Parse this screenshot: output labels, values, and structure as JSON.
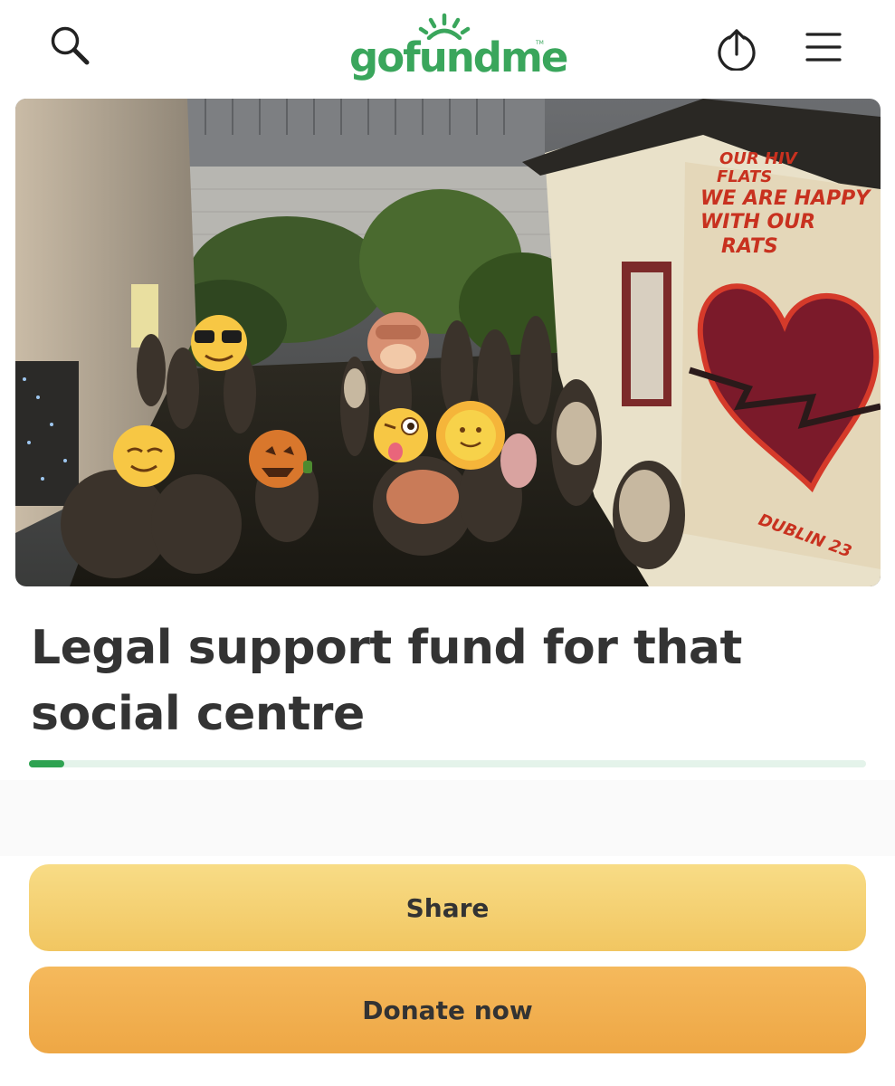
{
  "header": {
    "logo_text": "gofundme",
    "logo_tm": "TM",
    "icons": {
      "search": "search-icon",
      "share": "upload-share-icon",
      "menu": "hamburger-menu-icon"
    }
  },
  "hero": {
    "icon": "photo",
    "wall_text_lines": [
      "OUR HIV",
      "FLATS",
      "WE ARE HAPPY",
      "WITH OUR",
      "RATS"
    ],
    "wall_tag": "DUBLIN 23"
  },
  "campaign": {
    "title": "Legal support fund for that social centre",
    "progress_fraction": 0.042
  },
  "actions": {
    "share_label": "Share",
    "donate_label": "Donate now"
  },
  "colors": {
    "brand_green": "#3aa65c",
    "progress_fill": "#2ea351",
    "progress_track": "#e4f3ea",
    "share_button": "#f3cc6a",
    "donate_button": "#f0ad4c",
    "text": "#333333"
  }
}
